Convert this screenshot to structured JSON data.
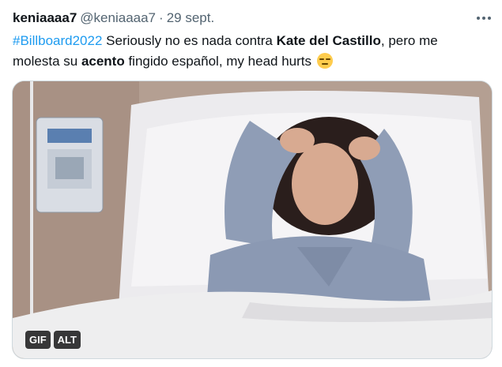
{
  "tweet": {
    "display_name": "keniaaaa7",
    "handle": "@keniaaaa7",
    "separator": "·",
    "date": "29 sept.",
    "text": {
      "hashtag": "#Billboard2022",
      "part1": " Seriously no es nada contra ",
      "bold1": "Kate del Castillo",
      "part2": ", pero me molesta su ",
      "bold2": "acento",
      "part3": " fingido español, my head hurts ",
      "emoji": "expressionless-face-emoji"
    }
  },
  "media": {
    "type": "gif",
    "gif_badge": "GIF",
    "alt_badge": "ALT"
  },
  "icons": {
    "more": "more-horizontal-icon"
  },
  "colors": {
    "link": "#1d9bf0",
    "secondary_text": "#536471",
    "primary_text": "#0f1419"
  }
}
